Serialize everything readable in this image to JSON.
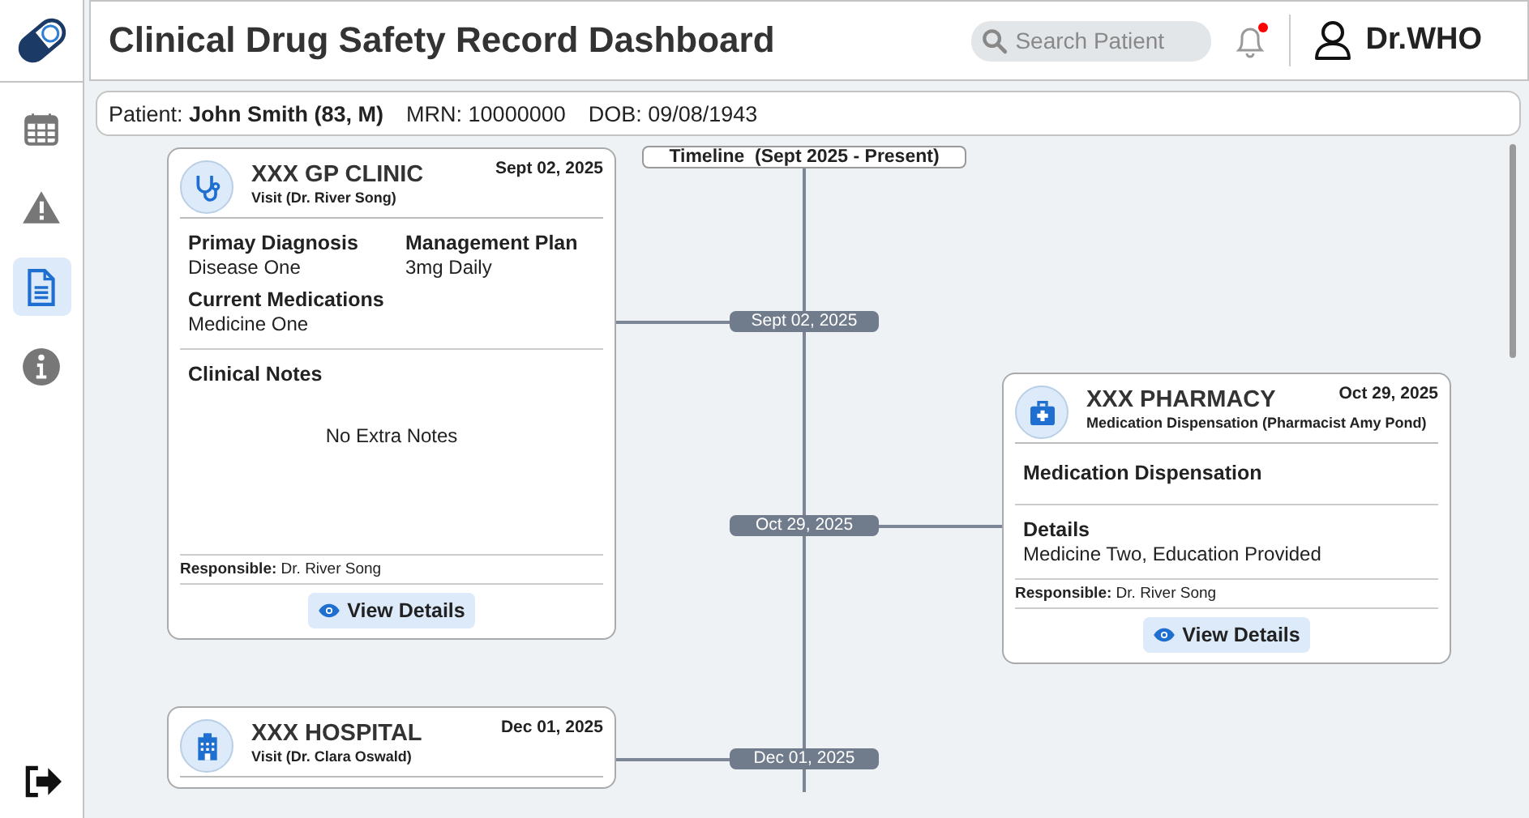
{
  "app": {
    "title": "Clinical Drug Safety Record Dashboard"
  },
  "search": {
    "placeholder": "Search Patient"
  },
  "notifications": {
    "unread": true
  },
  "user": {
    "name": "Dr.WHO"
  },
  "sidebar": {
    "items": [
      {
        "selected": false
      },
      {
        "selected": false
      },
      {
        "selected": true
      },
      {
        "selected": false
      }
    ]
  },
  "patient_bar": {
    "fields": [
      "Patient: **John Smith (83, M)**",
      "MRN: 10000000",
      "DOB: 09/08/1943"
    ]
  },
  "timeline": {
    "title": "Timeline  (Sept 2025 - Present)",
    "events": [
      {
        "pill": "Sept 02, 2025",
        "card": {
          "name": "XXX GP CLINIC",
          "subtitle": "Visit (Dr. River Song)",
          "date": "Sept 02, 2025",
          "sections": [
            {
              "kind": "grid",
              "fields": [
                {
                  "heading": "Primay Diagnosis",
                  "value": "Disease One"
                },
                {
                  "heading": "Management Plan",
                  "value": "3mg Daily"
                },
                {
                  "heading": "Current Medications",
                  "value": "Medicine One"
                }
              ]
            },
            {
              "kind": "notes",
              "heading": "Clinical Notes",
              "note": "No Extra Notes"
            }
          ],
          "responsible": "**Responsible:** Dr. River Song",
          "button": "View Details"
        }
      },
      {
        "pill": "Oct 29, 2025",
        "card": {
          "name": "XXX PHARMACY",
          "subtitle": "Medication Dispensation (Pharmacist Amy Pond)",
          "date": "Oct 29, 2025",
          "sections": [
            {
              "kind": "heading",
              "heading": "Medication Dispensation"
            },
            {
              "kind": "grid",
              "fields": [
                {
                  "heading": "Details",
                  "value": "Medicine Two, Education Provided"
                }
              ]
            }
          ],
          "responsible": "**Responsible:** Dr. River Song",
          "button": "View Details"
        }
      },
      {
        "pill": "Dec 01, 2025",
        "card": {
          "name": "XXX HOSPITAL",
          "subtitle": "Visit (Dr. Clara Oswald)",
          "date": "Dec 01, 2025"
        }
      }
    ]
  }
}
